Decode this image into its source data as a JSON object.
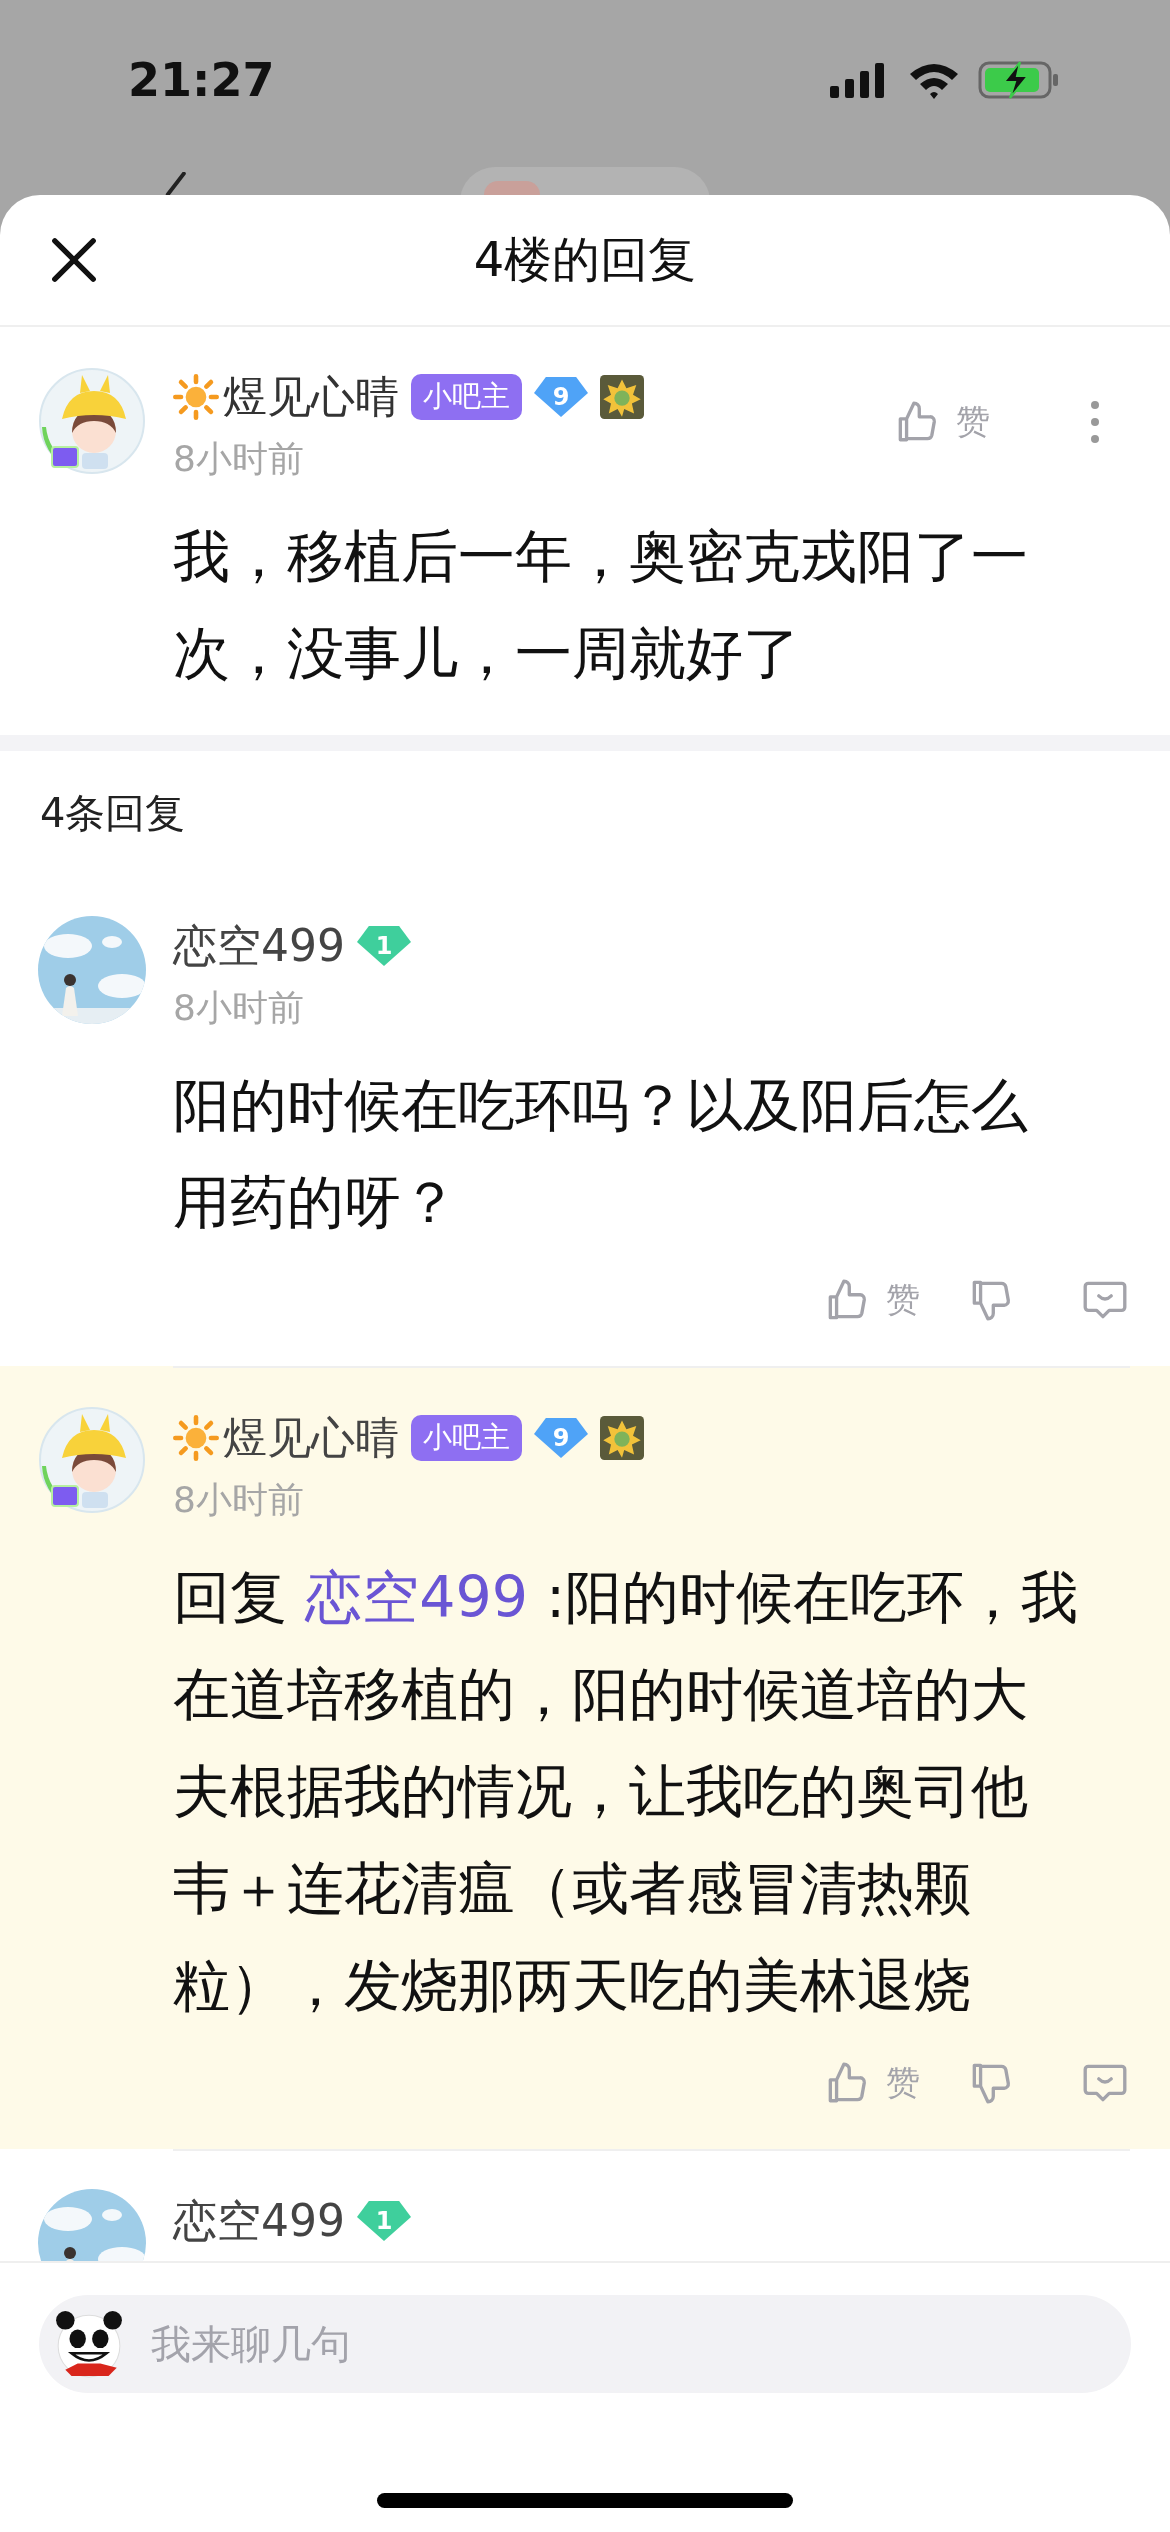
{
  "status_bar": {
    "time": "21:27"
  },
  "sheet": {
    "title": "4楼的回复"
  },
  "main_post": {
    "author": "煜见心晴",
    "name_icon": {
      "kind": "sun"
    },
    "avatar": {
      "kind": "hat"
    },
    "badges": [
      {
        "kind": "role",
        "label": "小吧主"
      },
      {
        "kind": "level",
        "label": "9",
        "color": "#4fa3f7"
      },
      {
        "kind": "medal"
      }
    ],
    "time": "8小时前",
    "text": "我，移植后一年，奥密克戎阳了一次，没事儿，一周就好了",
    "like_label": "赞"
  },
  "reply_count": "4条回复",
  "replies": [
    {
      "author": "恋空499",
      "avatar": {
        "kind": "sky"
      },
      "highlighted": false,
      "badges": [
        {
          "kind": "level",
          "label": "1",
          "color": "#3fcf9c"
        }
      ],
      "time": "8小时前",
      "text": "阳的时候在吃环吗？以及阳后怎么用药的呀？",
      "like_label": "赞"
    },
    {
      "author": "煜见心晴",
      "name_icon": {
        "kind": "sun"
      },
      "avatar": {
        "kind": "hat"
      },
      "highlighted": true,
      "badges": [
        {
          "kind": "role",
          "label": "小吧主"
        },
        {
          "kind": "level",
          "label": "9",
          "color": "#4fa3f7"
        },
        {
          "kind": "medal"
        }
      ],
      "time": "8小时前",
      "reply_prefix": "回复",
      "reply_to": "恋空499",
      "text": ":阳的时候在吃环，我在道培移植的，阳的时候道培的大夫根据我的情况，让我吃的奥司他韦＋连花清瘟（或者感冒清热颗粒），发烧那两天吃的美林退烧",
      "like_label": "赞"
    },
    {
      "author": "恋空499",
      "avatar": {
        "kind": "sky"
      },
      "highlighted": false,
      "badges": [
        {
          "kind": "level",
          "label": "1",
          "color": "#3fcf9c"
        }
      ]
    }
  ],
  "composer": {
    "placeholder": "我来聊几句"
  }
}
